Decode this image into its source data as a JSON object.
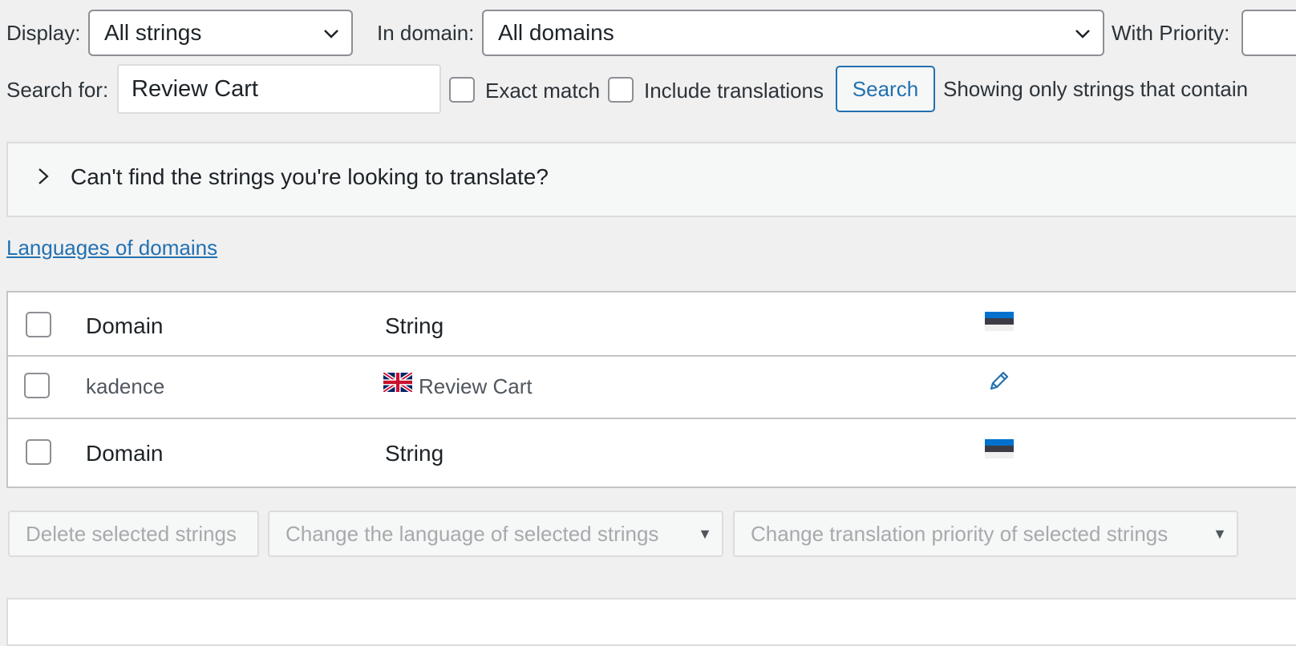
{
  "filters": {
    "display_label": "Display:",
    "display_value": "All strings",
    "domain_label": "In domain:",
    "domain_value": "All domains",
    "priority_label": "With Priority:",
    "search_label": "Search for:",
    "search_value": "Review Cart",
    "exact_match_label": "Exact match",
    "include_translations_label": "Include translations",
    "search_button": "Search",
    "showing_text": "Showing only strings that contain"
  },
  "help_panel": {
    "text": "Can't find the strings you're looking to translate?"
  },
  "languages_link": "Languages of domains",
  "table": {
    "header": {
      "domain": "Domain",
      "string": "String"
    },
    "rows": [
      {
        "domain": "kadence",
        "string": "Review Cart"
      }
    ],
    "footer": {
      "domain": "Domain",
      "string": "String"
    }
  },
  "bulk_actions": {
    "delete_button": "Delete selected strings",
    "change_language": "Change the language of selected strings",
    "change_priority": "Change translation priority of selected strings"
  },
  "colors": {
    "accent": "#2271b1",
    "flag_estonia_blue": "#0072ce",
    "flag_estonia_black": "#3c3c46"
  }
}
